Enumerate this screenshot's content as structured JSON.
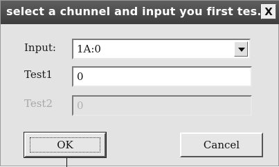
{
  "dialog": {
    "title": "select a chunnel and input you first tes...",
    "close_label": "X"
  },
  "form": {
    "input_label": "Input:",
    "input_value": "1A:0",
    "test1_label": "Test1",
    "test1_value": "0",
    "test2_label": "Test2",
    "test2_value": "0"
  },
  "buttons": {
    "ok_label": "OK",
    "cancel_label": "Cancel"
  }
}
